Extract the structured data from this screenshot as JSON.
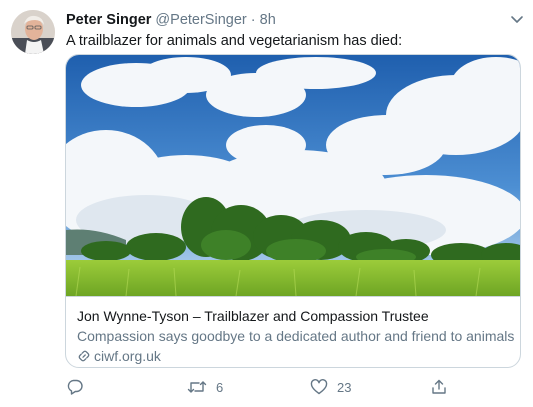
{
  "tweet": {
    "author_name": "Peter Singer",
    "handle": "@PeterSinger",
    "separator": "·",
    "time": "8h",
    "text": "A trailblazer for animals and vegetarianism has died:"
  },
  "card": {
    "title": "Jon Wynne-Tyson – Trailblazer and Compassion Trustee",
    "description": "Compassion says goodbye to a dedicated author and friend to animals",
    "domain": "ciwf.org.uk"
  },
  "actions": {
    "reply": {
      "icon": "reply-icon",
      "count": ""
    },
    "retweet": {
      "icon": "retweet-icon",
      "count": "6"
    },
    "like": {
      "icon": "heart-icon",
      "count": "23"
    },
    "share": {
      "icon": "share-icon",
      "count": ""
    }
  },
  "colors": {
    "text": "#14171a",
    "secondary": "#657786",
    "border": "#ccd6dd"
  }
}
